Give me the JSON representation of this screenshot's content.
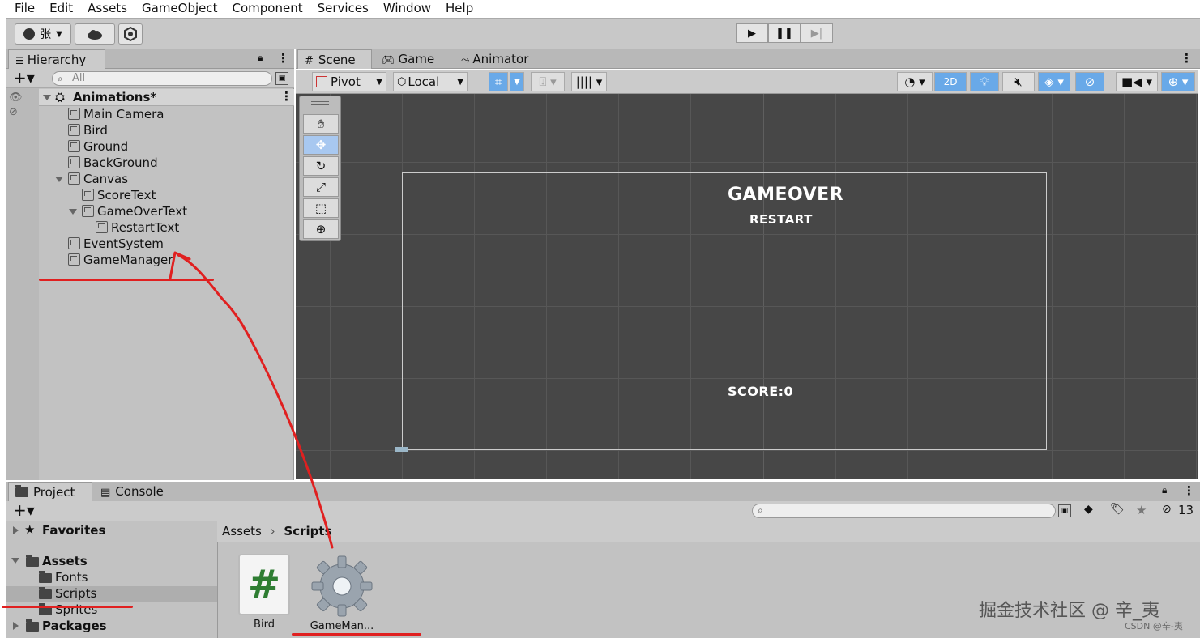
{
  "menu": [
    "File",
    "Edit",
    "Assets",
    "GameObject",
    "Component",
    "Services",
    "Window",
    "Help"
  ],
  "toolbar": {
    "account_label": "张"
  },
  "hierarchy": {
    "tab_label": "Hierarchy",
    "search_placeholder": "All",
    "scene_name": "Animations*",
    "items": [
      {
        "label": "Main Camera",
        "depth": 1
      },
      {
        "label": "Bird",
        "depth": 1
      },
      {
        "label": "Ground",
        "depth": 1
      },
      {
        "label": "BackGround",
        "depth": 1
      },
      {
        "label": "Canvas",
        "depth": 1
      },
      {
        "label": "ScoreText",
        "depth": 2
      },
      {
        "label": "GameOverText",
        "depth": 2
      },
      {
        "label": "RestartText",
        "depth": 3
      },
      {
        "label": "EventSystem",
        "depth": 1
      },
      {
        "label": "GameManager",
        "depth": 1
      }
    ]
  },
  "scene_tabs": {
    "scene": "Scene",
    "game": "Game",
    "animator": "Animator"
  },
  "scene_toolbar": {
    "pivot": "Pivot",
    "local": "Local",
    "mode_2d": "2D"
  },
  "scene_view": {
    "gameover": "GAMEOVER",
    "restart": "RESTART",
    "score": "SCORE:0"
  },
  "project": {
    "tab_project": "Project",
    "tab_console": "Console",
    "hidden_count": "13",
    "tree": {
      "favorites": "Favorites",
      "assets": "Assets",
      "fonts": "Fonts",
      "scripts": "Scripts",
      "sprites": "Sprites",
      "packages": "Packages"
    },
    "breadcrumb": {
      "root": "Assets",
      "current": "Scripts"
    },
    "files": [
      {
        "name": "Bird",
        "type": "script"
      },
      {
        "name": "GameMan...",
        "type": "gear"
      }
    ]
  },
  "watermark": {
    "main": "掘金技术社区 @ 辛_夷",
    "sub": "CSDN @辛-夷"
  },
  "colors": {
    "viewport": "#474747",
    "annotation": "#e02020",
    "selection": "#69a9e8"
  }
}
